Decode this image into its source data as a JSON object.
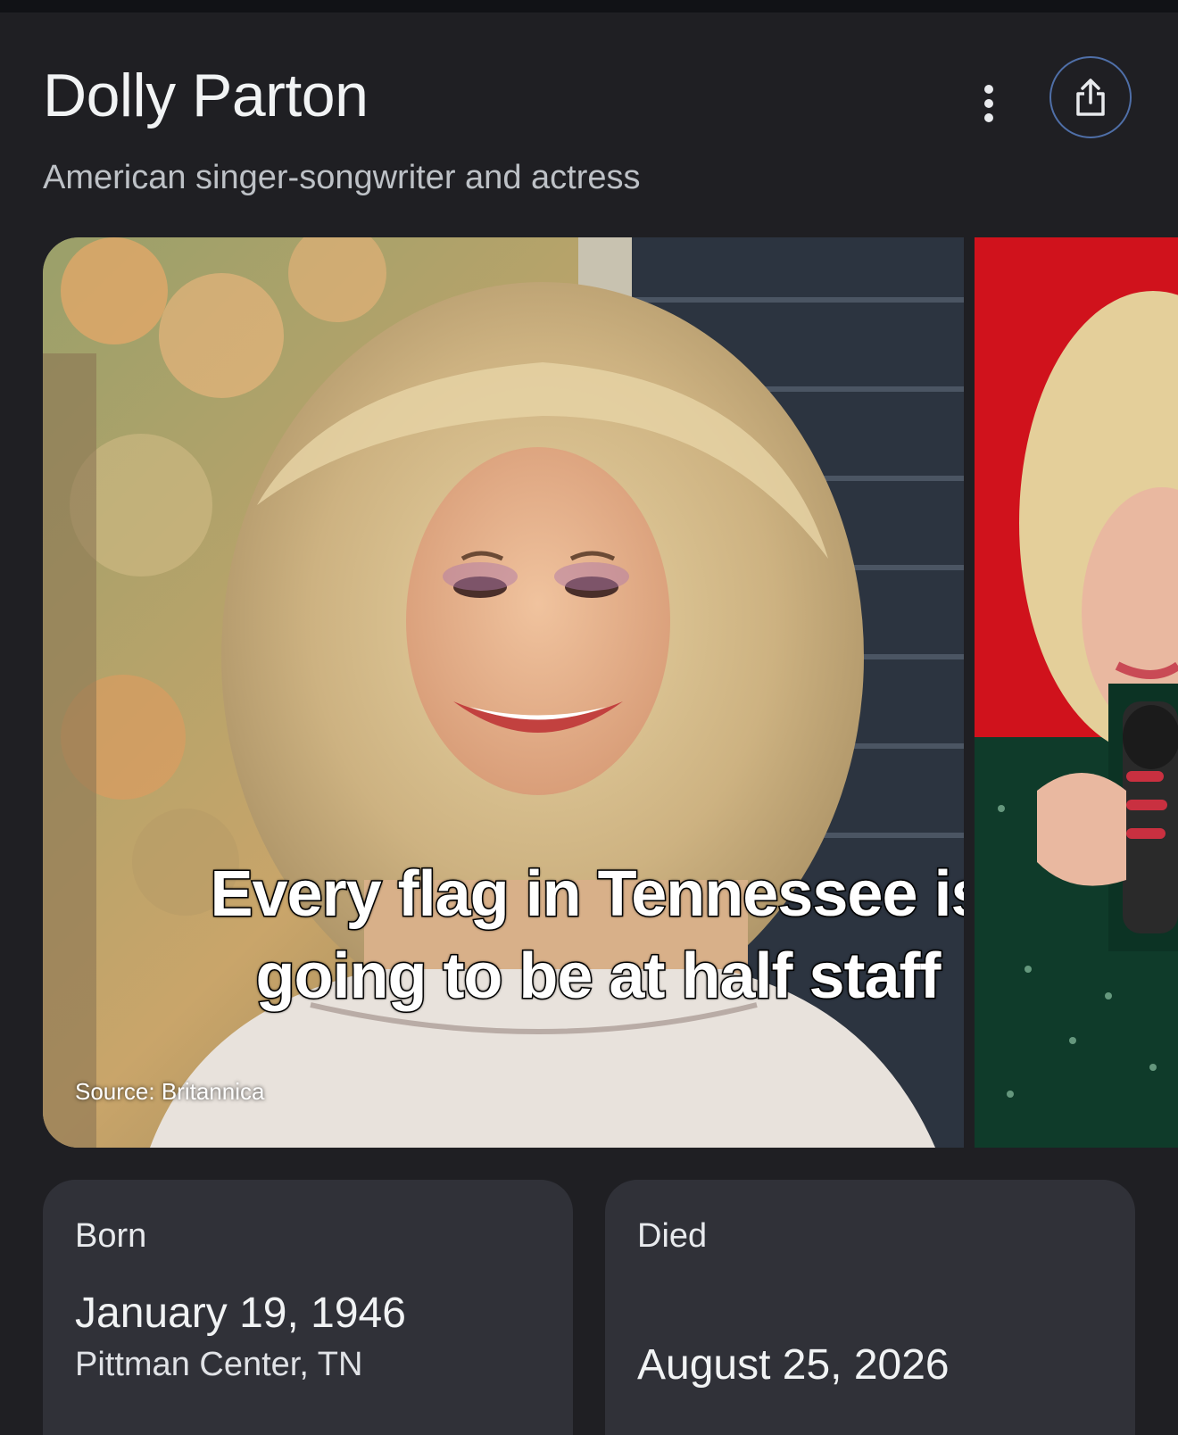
{
  "header": {
    "title": "Dolly Parton",
    "subtitle": "American singer-songwriter and actress",
    "more_icon": "more-vert-icon",
    "share_icon": "share-icon"
  },
  "images": {
    "main": {
      "caption_line1": "Every flag in Tennessee is",
      "caption_line2": "going to be at half staff",
      "source": "Source: Britannica"
    }
  },
  "facts": {
    "born": {
      "label": "Born",
      "date": "January 19, 1946",
      "place": "Pittman Center, TN"
    },
    "died": {
      "label": "Died",
      "date": "August 25, 2026"
    }
  },
  "colors": {
    "background": "#1f1f23",
    "card": "#303138",
    "share_ring": "#4f6fa8"
  }
}
